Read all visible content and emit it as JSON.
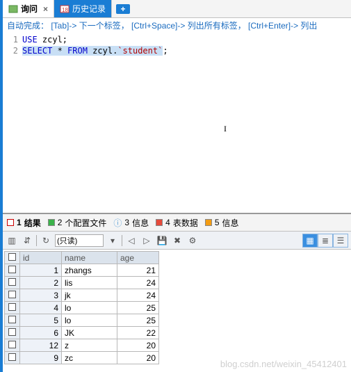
{
  "tabs": {
    "query": "询问",
    "history": "历史记录",
    "plus": "+"
  },
  "hint": "自动完成： [Tab]-> 下一个标签， [Ctrl+Space]-> 列出所有标签， [Ctrl+Enter]-> 列出",
  "editor": {
    "line1_no": "1",
    "line2_no": "2",
    "use_kw": "USE",
    "db": " zcyl;",
    "select_kw": "SELECT",
    "star": " * ",
    "from_kw": "FROM",
    "tbl_a": " zcyl.",
    "tbl_b": "`student`",
    "semi": ";"
  },
  "result_tabs": {
    "r1_num": "1",
    "r1": "结果",
    "r2_num": "2",
    "r2": "个配置文件",
    "r3_num": "3",
    "r3": "信息",
    "r4_num": "4",
    "r4": "表数据",
    "r5_num": "5",
    "r5": "信息"
  },
  "toolbar": {
    "readonly": "(只读)",
    "dd": "▾",
    "nav1": "◁",
    "nav2": "▷",
    "save": "💾",
    "del": "✖",
    "cfg": "⚙",
    "grid": "▦",
    "list": "≣",
    "card": "☰"
  },
  "grid": {
    "headers": {
      "id": "id",
      "name": "name",
      "age": "age"
    },
    "rows": [
      {
        "id": "1",
        "name": "zhangs",
        "age": "21"
      },
      {
        "id": "2",
        "name": "lis",
        "age": "24"
      },
      {
        "id": "3",
        "name": "jk",
        "age": "24"
      },
      {
        "id": "4",
        "name": "lo",
        "age": "25"
      },
      {
        "id": "5",
        "name": "lo",
        "age": "25"
      },
      {
        "id": "6",
        "name": "JK",
        "age": "22"
      },
      {
        "id": "12",
        "name": "z",
        "age": "20"
      },
      {
        "id": "9",
        "name": "zc",
        "age": "20"
      }
    ]
  },
  "watermark": "blog.csdn.net/weixin_45412401"
}
